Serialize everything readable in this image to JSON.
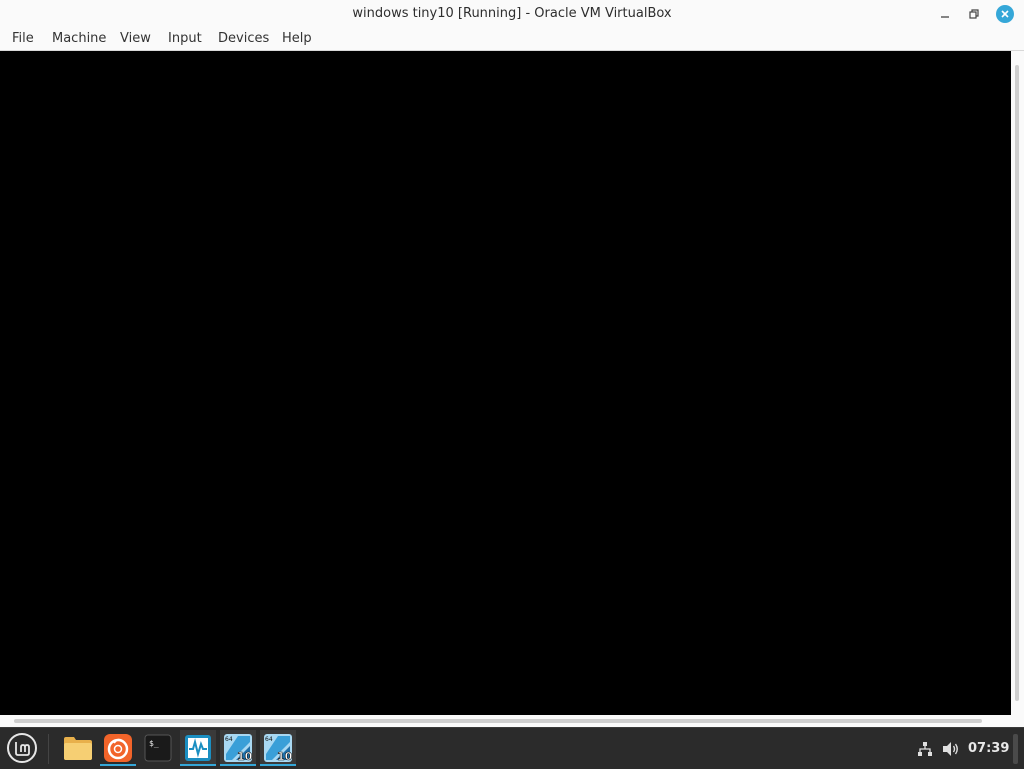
{
  "window": {
    "title": "windows tiny10 [Running] - Oracle VM VirtualBox"
  },
  "menu": {
    "items": [
      "File",
      "Machine",
      "View",
      "Input",
      "Devices",
      "Help"
    ]
  },
  "taskbar": {
    "menu_icon": "linux-mint-menu-icon",
    "apps": [
      {
        "name": "file-manager-icon",
        "active": false
      },
      {
        "name": "firefox-icon",
        "active": false
      },
      {
        "name": "terminal-icon",
        "active": false
      },
      {
        "name": "virtualbox-manager-icon",
        "active": true
      },
      {
        "name": "tiny10-vm-icon",
        "active": true
      },
      {
        "name": "tiny10-vm-icon",
        "active": true
      }
    ],
    "vm_badge_arch": "64",
    "vm_badge_version": "10",
    "terminal_prompt": "$_",
    "tray": {
      "network_icon": "network-icon",
      "volume_icon": "volume-icon"
    },
    "clock": "07:39"
  },
  "colors": {
    "accent": "#35a7d8",
    "vm_screen": "#000000",
    "taskbar": "#2b2b2b"
  }
}
